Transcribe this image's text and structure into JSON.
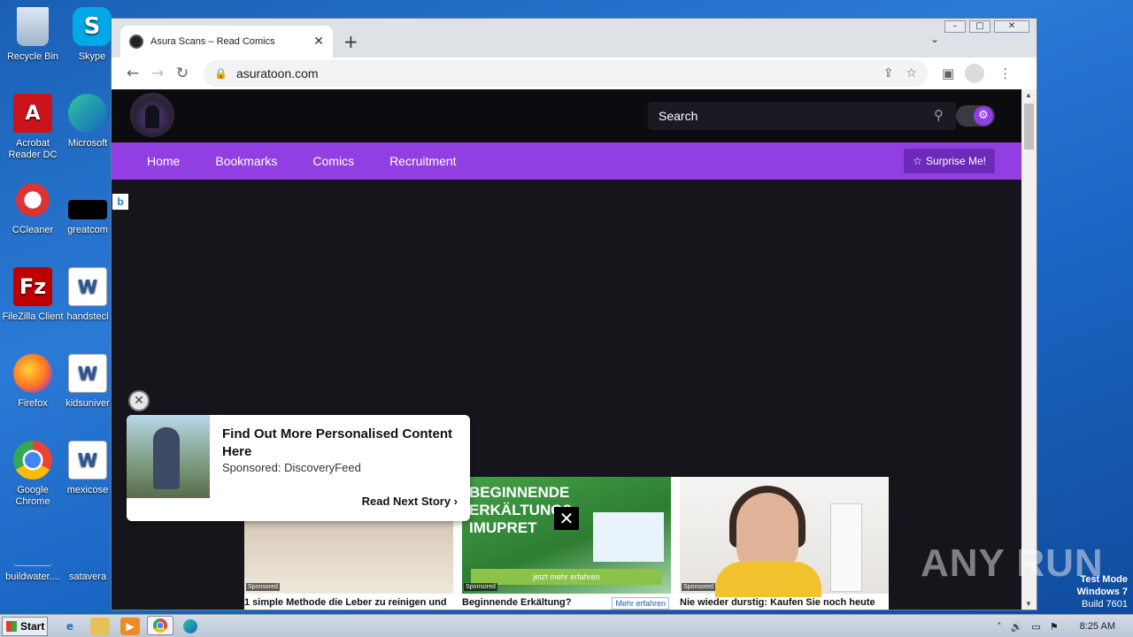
{
  "desktop": {
    "icons": [
      {
        "label": "Recycle Bin",
        "icon": "recycle-bin-icon"
      },
      {
        "label": "Skype",
        "icon": "skype-icon"
      },
      {
        "label": "Acrobat Reader DC",
        "icon": "acrobat-icon"
      },
      {
        "label": "Microsoft",
        "icon": "edge-icon"
      },
      {
        "label": "CCleaner",
        "icon": "ccleaner-icon"
      },
      {
        "label": "greatcom",
        "icon": "file-icon"
      },
      {
        "label": "FileZilla Client",
        "icon": "filezilla-icon"
      },
      {
        "label": "handstecl",
        "icon": "word-icon"
      },
      {
        "label": "Firefox",
        "icon": "firefox-icon"
      },
      {
        "label": "kidsuniver",
        "icon": "word-icon"
      },
      {
        "label": "Google Chrome",
        "icon": "chrome-icon"
      },
      {
        "label": "mexicose",
        "icon": "word-icon"
      },
      {
        "label": "buildwater....",
        "icon": "file-icon"
      },
      {
        "label": "satavera",
        "icon": "file-icon"
      }
    ]
  },
  "browser": {
    "tab_title": "Asura Scans – Read Comics",
    "url": "asuratoon.com",
    "window_controls": [
      "minimize",
      "maximize",
      "close"
    ]
  },
  "site": {
    "search_placeholder": "Search",
    "nav": [
      "Home",
      "Bookmarks",
      "Comics",
      "Recruitment"
    ],
    "surprise_label": "Surprise Me!",
    "accent": "#913fe2",
    "bing_badge": "b"
  },
  "popup_ad": {
    "headline": "Find Out More Personalised Content Here",
    "sponsor": "Sponsored: DiscoveryFeed",
    "read_next": "Read Next Story ›"
  },
  "ad_strip": {
    "cards": [
      {
        "sponsored": "Sponsored",
        "caption": "1 simple Methode die Leber zu reinigen und"
      },
      {
        "sponsored": "Sponsored",
        "caption": "Beginnende Erkältung?",
        "headline_top": "BEGINNENDE",
        "headline_mid": "ERKÄLTUNG?",
        "product": "IMUPRET",
        "cta": "jetzt mehr erfahren",
        "more": "Mehr erfahren"
      },
      {
        "sponsored": "Sponsored",
        "caption": "Nie wieder durstig: Kaufen Sie noch heute"
      }
    ]
  },
  "watermark": "ANY RUN",
  "system": {
    "testmode_line1": "Test Mode",
    "testmode_line2": "Windows 7",
    "testmode_line3": "Build 7601",
    "start_label": "Start",
    "clock": "8:25 AM"
  }
}
